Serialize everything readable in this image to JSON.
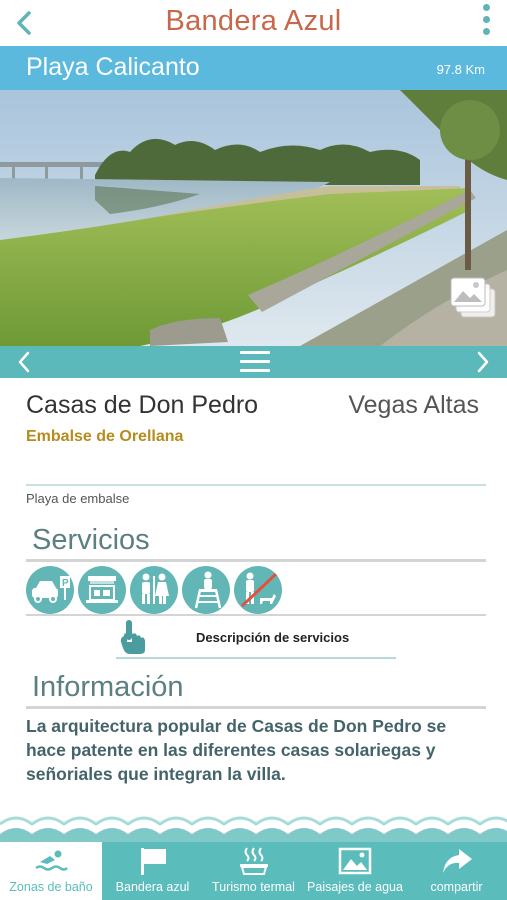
{
  "header": {
    "title": "Bandera Azul",
    "back_icon": "chevron-left-icon",
    "menu_icon": "vertical-dots-icon"
  },
  "beach": {
    "name": "Playa Calicanto",
    "distance": "97.8 Km"
  },
  "carousel": {
    "prev_icon": "chevron-left-icon",
    "menu_icon": "hamburger-icon",
    "next_icon": "chevron-right-icon",
    "gallery_icon": "photo-gallery-icon"
  },
  "location": {
    "town": "Casas de Don Pedro",
    "region": "Vegas Altas",
    "reservoir": "Embalse de Orellana",
    "beach_type": "Playa de embalse"
  },
  "services": {
    "title": "Servicios",
    "icons": [
      "car-parking-icon",
      "kiosk-icon",
      "restrooms-icon",
      "lifeguard-icon",
      "no-dogs-icon"
    ],
    "description_link": "Descripción de servicios",
    "tap_icon": "tap-hand-icon"
  },
  "info": {
    "title": "Información",
    "text": "La arquitectura popular de Casas de Don Pedro se hace patente en las diferentes casas solariegas y señoriales que integran la villa."
  },
  "tabs": [
    {
      "label": "Zonas de baño",
      "icon": "swimmer-icon",
      "active": true
    },
    {
      "label": "Bandera azul",
      "icon": "flag-icon",
      "active": false
    },
    {
      "label": "Turismo termal",
      "icon": "hot-spring-icon",
      "active": false
    },
    {
      "label": "Paisajes de agua",
      "icon": "landscape-image-icon",
      "active": false
    },
    {
      "label": "compartir",
      "icon": "share-arrow-icon",
      "active": false
    }
  ],
  "colors": {
    "accent": "#5bbcbc",
    "title": "#c8684a",
    "beach_bar": "#5bb9de",
    "reservoir": "#b58c1d"
  }
}
